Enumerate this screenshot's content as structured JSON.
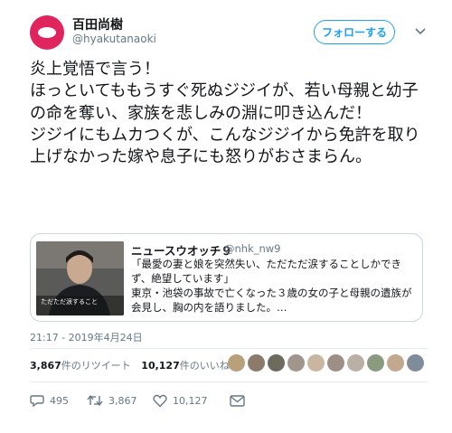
{
  "author": {
    "name": "百田尚樹",
    "handle": "@hyakutanaoki"
  },
  "follow_button": {
    "label": "フォローする"
  },
  "tweet": {
    "text": "炎上覚悟で言う！\nほっといてももうすぐ死ぬジジイが、若い母親と幼子の命を奪い、家族を悲しみの淵に叩き込んだ！\nジジイにもムカつくが、こんなジジイから免許を取り上げなかった嫁や息子にも怒りがおさまらん。"
  },
  "quoted": {
    "author": "ニュースウオッチ９",
    "handle": "@nhk_nw9",
    "text": "「最愛の妻と娘を突然失い、ただただ涙することしかできず、絶望しています」\n東京・池袋の事故で亡くなった３歳の女の子と母親の遺族が会見し、胸の内を語りました。…",
    "thumb_caption": "ただただ涙すること"
  },
  "timestamp": "21:17 - 2019年4月24日",
  "stats": {
    "retweets_count": "3,867",
    "retweets_label": "件のリツイート",
    "likes_count": "10,127",
    "likes_label": "件のいいね"
  },
  "liker_avatar_colors": [
    "#b7a07a",
    "#8c7b6a",
    "#6d6a5e",
    "#a0968c",
    "#c9b6a0",
    "#9d8f85",
    "#b9b0a6",
    "#8a9a7e",
    "#c2a88e",
    "#7f8c9a"
  ],
  "actions": {
    "reply_count": "495",
    "retweet_count": "3,867",
    "like_count": "10,127"
  },
  "colors": {
    "accent": "#1da1f2",
    "avatar": "#e0245e",
    "muted": "#657786"
  },
  "icons": [
    "caret-down-icon",
    "reply-icon",
    "retweet-icon",
    "heart-icon",
    "mail-icon"
  ]
}
